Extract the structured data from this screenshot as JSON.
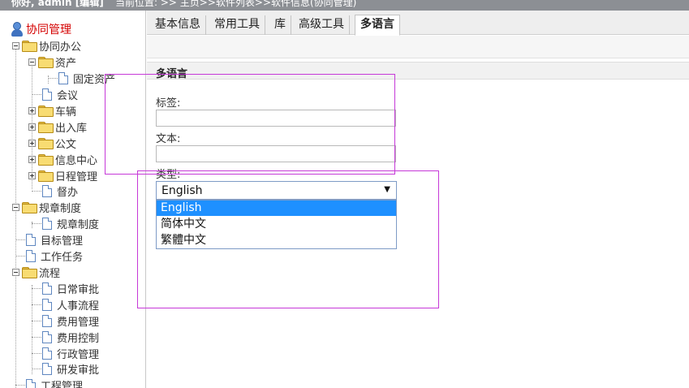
{
  "header": {
    "greeting": "你好, admin [编辑]",
    "location": "当前位置: >> 主页>>软件列表>>软件信息(协同管理)"
  },
  "sidebar": {
    "root": "协同管理",
    "items": [
      {
        "label": "协同办公"
      },
      {
        "label": "资产"
      },
      {
        "label": "固定资产"
      },
      {
        "label": "会议"
      },
      {
        "label": "车辆"
      },
      {
        "label": "出入库"
      },
      {
        "label": "公文"
      },
      {
        "label": "信息中心"
      },
      {
        "label": "日程管理"
      },
      {
        "label": "督办"
      },
      {
        "label": "规章制度"
      },
      {
        "label": "规章制度"
      },
      {
        "label": "目标管理"
      },
      {
        "label": "工作任务"
      },
      {
        "label": "流程"
      },
      {
        "label": "日常审批"
      },
      {
        "label": "人事流程"
      },
      {
        "label": "费用管理"
      },
      {
        "label": "费用控制"
      },
      {
        "label": "行政管理"
      },
      {
        "label": "研发审批"
      },
      {
        "label": "工程管理"
      }
    ]
  },
  "tabs": [
    {
      "label": "基本信息"
    },
    {
      "label": "常用工具"
    },
    {
      "label": "库"
    },
    {
      "label": "高级工具"
    },
    {
      "label": "多语言"
    }
  ],
  "form": {
    "section_title": "多语言",
    "tag_label": "标签:",
    "tag_value": "",
    "text_label": "文本:",
    "text_value": "",
    "type_label": "类型:",
    "type_selected": "English",
    "type_options": [
      "English",
      "简体中文",
      "繁體中文"
    ]
  },
  "colors": {
    "selected_option": "#1e90ff",
    "annotation": "#c639d8",
    "root_label": "#d40000"
  }
}
